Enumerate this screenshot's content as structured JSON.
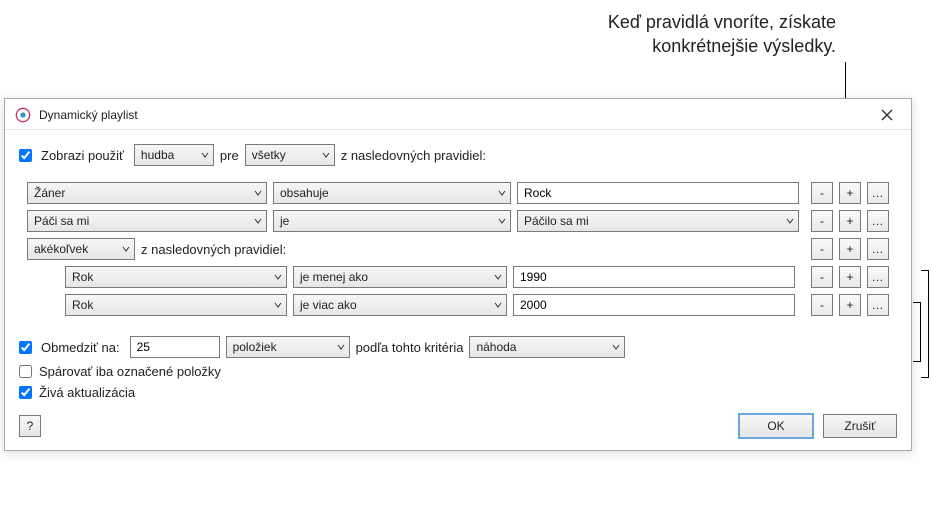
{
  "annotation": {
    "line1": "Keď pravidlá vnoríte, získate",
    "line2": "konkrétnejšie výsledky."
  },
  "window": {
    "title": "Dynamický playlist",
    "close_label": "×"
  },
  "header": {
    "show_match_checked": true,
    "show_match_label": "Zobrazi použiť",
    "media": "hudba",
    "for_label": "pre",
    "match_mode": "všetky",
    "suffix": "z nasledovných pravidiel:"
  },
  "rules": [
    {
      "field": "Žáner",
      "operator": "obsahuje",
      "value_type": "text",
      "value": "Rock"
    },
    {
      "field": "Páči sa mi",
      "operator": "je",
      "value_type": "select",
      "value": "Páčilo sa mi"
    }
  ],
  "nested": {
    "mode": "akékoľvek",
    "suffix": "z nasledovných pravidiel:",
    "rules": [
      {
        "field": "Rok",
        "operator": "je menej ako",
        "value": "1990"
      },
      {
        "field": "Rok",
        "operator": "je viac ako",
        "value": "2000"
      }
    ]
  },
  "limit": {
    "checked": true,
    "label": "Obmedziť na:",
    "value": "25",
    "unit": "položiek",
    "criteria_label": "podľa tohto kritéria",
    "criteria": "náhoda"
  },
  "match_checked_only": {
    "checked": false,
    "label": "Spárovať iba označené položky"
  },
  "live_update": {
    "checked": true,
    "label": "Živá aktualizácia"
  },
  "buttons": {
    "help": "?",
    "ok": "OK",
    "cancel": "Zrušiť",
    "minus": "-",
    "plus": "+",
    "dots": "…"
  }
}
